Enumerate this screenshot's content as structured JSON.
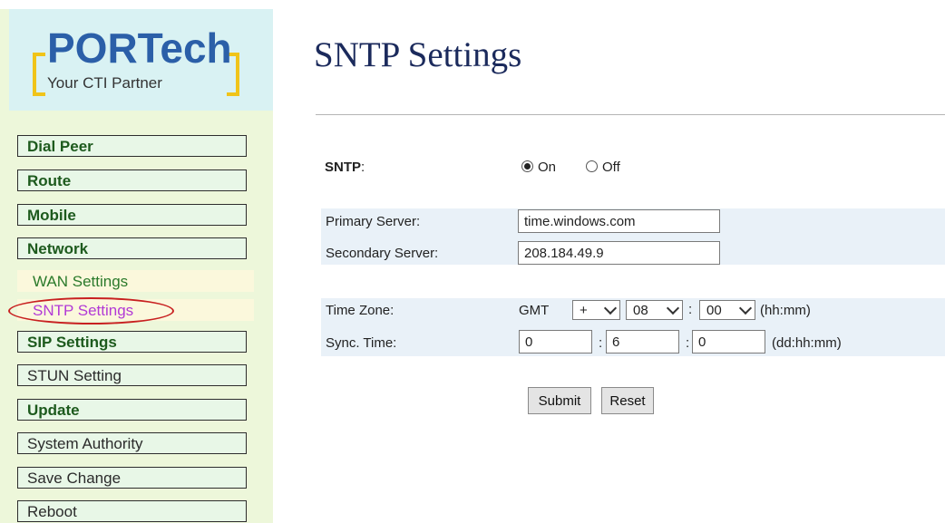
{
  "logo": {
    "brand": "PORTech",
    "tagline": "Your CTI Partner"
  },
  "sidebar": {
    "items": [
      {
        "label": "Dial Peer",
        "bold": true
      },
      {
        "label": "Route",
        "bold": true
      },
      {
        "label": "Mobile",
        "bold": true
      },
      {
        "label": "Network",
        "bold": true
      },
      {
        "label": "WAN Settings",
        "sub": true
      },
      {
        "label": "SNTP Settings",
        "sub": true,
        "active": true
      },
      {
        "label": "SIP Settings",
        "bold": true
      },
      {
        "label": "STUN Setting",
        "bold": false
      },
      {
        "label": "Update",
        "bold": true
      },
      {
        "label": "System Authority",
        "bold": false
      },
      {
        "label": "Save Change",
        "bold": false
      },
      {
        "label": "Reboot",
        "bold": false
      }
    ]
  },
  "page": {
    "title": "SNTP Settings"
  },
  "form": {
    "sntp": {
      "label": "SNTP",
      "colon": ":",
      "on_label": "On",
      "off_label": "Off",
      "selected": "On"
    },
    "primary_server": {
      "label": "Primary Server:",
      "value": "time.windows.com"
    },
    "secondary_server": {
      "label": "Secondary Server:",
      "value": "208.184.49.9"
    },
    "time_zone": {
      "label": "Time Zone:",
      "prefix": "GMT",
      "sign": "+",
      "hours": "08",
      "separator": ":",
      "minutes": "00",
      "unit": "(hh:mm)"
    },
    "sync_time": {
      "label": "Sync. Time:",
      "days": "0",
      "hours": "6",
      "minutes": "0",
      "separator": ":",
      "unit": "(dd:hh:mm)"
    },
    "submit_label": "Submit",
    "reset_label": "Reset"
  },
  "colors": {
    "sidebar_bg": "#edf7da",
    "logo_bg": "#d9f2f3",
    "row_bg": "#e9f1f8",
    "title": "#1b2a5c",
    "highlight": "#c82020"
  }
}
